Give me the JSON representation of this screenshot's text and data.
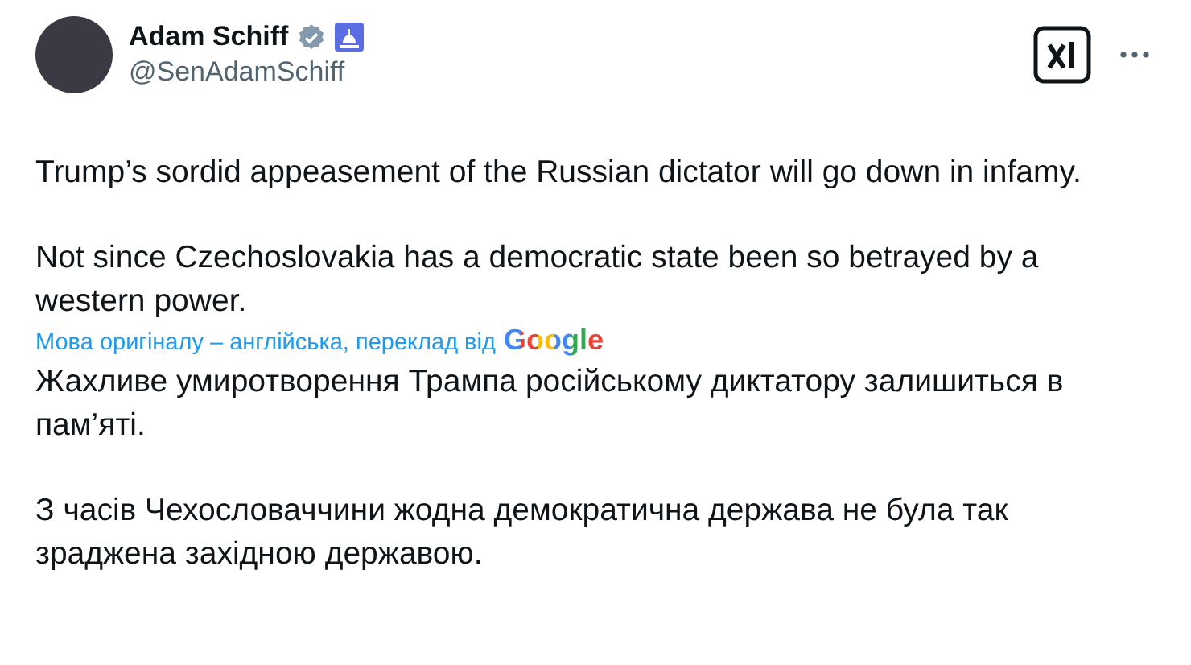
{
  "author": {
    "name": "Adam Schiff",
    "handle": "@SenAdamSchiff",
    "verified": true
  },
  "paragraphs": [
    "Trump’s sordid appeasement of the Russian dictator will go down in infamy.",
    "Not since Czechoslovakia has a democratic state been so betrayed by a western power."
  ],
  "translation": {
    "note": "Мова оригіналу – англійська, переклад від",
    "provider": "Google",
    "paragraphs": [
      "Жахливе умиротворення Трампа російському диктатору залишиться в пам’яті.",
      "З часів Чехословаччини жодна демократична держава не була так зраджена західною державою."
    ]
  }
}
